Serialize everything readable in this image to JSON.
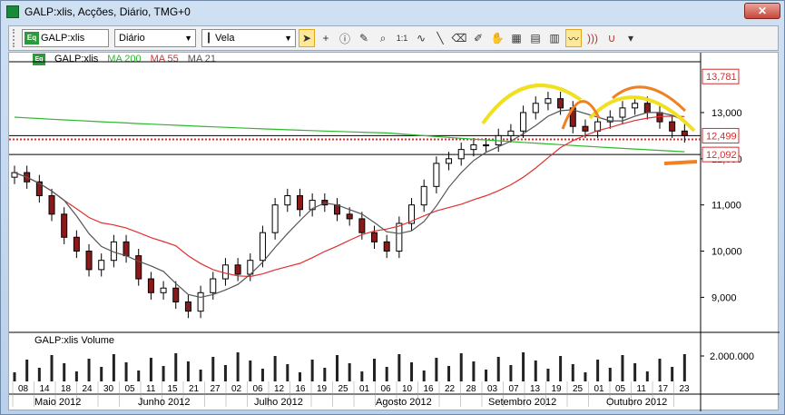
{
  "window": {
    "title": "GALP:xlis, Acções, Diário, TMG+0",
    "close_label": "✕"
  },
  "toolbar": {
    "symbol": "GALP:xlis",
    "period": "Diário",
    "chart_style": "Vela",
    "eq_badge": "Eq",
    "zoom_label": "1:1",
    "tools": [
      "cursor-tool",
      "crosshair-tool",
      "info-tool",
      "pencil-tool",
      "zoom-tool",
      "one-to-one-tool",
      "wave-tool",
      "line-tool",
      "eraser-tool",
      "pen-tool",
      "hand-tool",
      "grid-tool",
      "abc-tool",
      "chart-color-tool",
      "indicator-tool",
      "signal-tool",
      "magnet-tool",
      "more-tool"
    ]
  },
  "legend": {
    "symbol": "GALP:xlis",
    "ma200": "MA 200",
    "ma55": "MA 55",
    "ma21": "MA 21"
  },
  "price_labels": {
    "high": "13,781",
    "l1": "12,499",
    "l2": "12,092"
  },
  "volume_panel": {
    "title": "GALP:xlis Volume",
    "axis_label": "2.000.000"
  },
  "chart_data": {
    "type": "candlestick",
    "y_axis_ticks": [
      "13,000",
      "12,000",
      "11,000",
      "10,000",
      "9,000"
    ],
    "ylim": [
      8.3,
      14.1
    ],
    "date_ticks": [
      "08",
      "14",
      "18",
      "24",
      "30",
      "05",
      "11",
      "15",
      "21",
      "27",
      "02",
      "06",
      "12",
      "16",
      "19",
      "25",
      "01",
      "06",
      "10",
      "16",
      "22",
      "28",
      "03",
      "07",
      "13",
      "19",
      "25",
      "01",
      "05",
      "11",
      "17",
      "23"
    ],
    "months": [
      "Maio 2012",
      "Junho 2012",
      "Julho 2012",
      "Agosto 2012",
      "Setembro 2012",
      "Outubro 2012"
    ],
    "horizontal_levels": [
      13.781,
      12.499,
      12.092
    ],
    "close_series_approx": [
      11.7,
      11.5,
      11.2,
      10.8,
      10.3,
      10.0,
      9.6,
      9.8,
      10.2,
      9.9,
      9.4,
      9.1,
      9.2,
      8.9,
      8.7,
      9.1,
      9.4,
      9.7,
      9.5,
      9.8,
      10.4,
      11.0,
      11.2,
      10.9,
      11.1,
      11.0,
      10.8,
      10.7,
      10.4,
      10.2,
      10.0,
      10.6,
      11.0,
      11.4,
      11.9,
      12.0,
      12.2,
      12.3,
      12.3,
      12.5,
      12.6,
      13.0,
      13.2,
      13.3,
      13.1,
      12.7,
      12.6,
      12.8,
      12.9,
      13.1,
      13.2,
      13.0,
      12.8,
      12.6,
      12.5
    ]
  },
  "colors": {
    "ma200": "#2db82d",
    "ma55": "#e03030",
    "ma21": "#555555",
    "annotation_yellow": "#f0e020",
    "annotation_orange": "#f08020",
    "level_line": "#000000",
    "dotted_level": "#d03030"
  }
}
